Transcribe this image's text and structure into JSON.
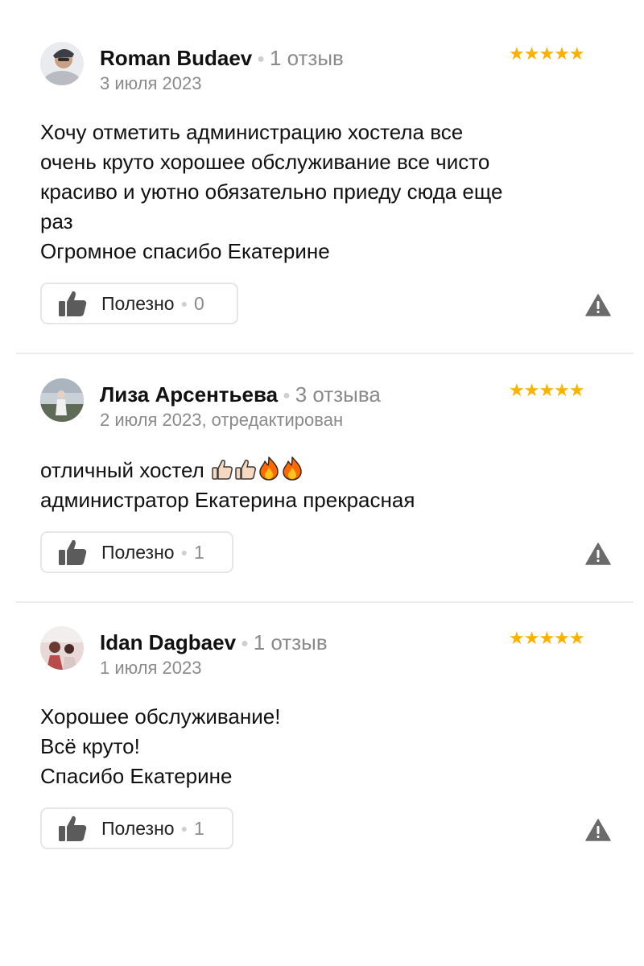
{
  "colors": {
    "star": "#fcb100",
    "muted": "#8a8a8a",
    "divider": "#ebebeb"
  },
  "reviews": [
    {
      "author": "Roman Budaev",
      "review_count": "1 отзыв",
      "date": "3 июля 2023",
      "rating": 5,
      "stars": "★★★★★",
      "text_lines": [
        "Хочу отметить администрацию хостела все",
        "очень круто хорошее обслуживание все чисто",
        "красиво и уютно обязательно приеду сюда еще",
        "раз",
        "Огромное спасибо Екатерине"
      ],
      "useful_label": "Полезно",
      "useful_count": "0"
    },
    {
      "author": "Лиза Арсентьева",
      "review_count": "3 отзыва",
      "date": "2 июля 2023, отредактирован",
      "rating": 5,
      "stars": "★★★★★",
      "text_line1": "отличный хостел",
      "text_line1_emojis": [
        "thumbs-up-icon",
        "thumbs-up-icon",
        "fire-icon",
        "fire-icon"
      ],
      "text_line2": "администратор Екатерина прекрасная",
      "useful_label": "Полезно",
      "useful_count": "1"
    },
    {
      "author": "Idan Dagbaev",
      "review_count": "1 отзыв",
      "date": "1 июля 2023",
      "rating": 5,
      "stars": "★★★★★",
      "text_lines": [
        "Хорошее обслуживание!",
        "Всё круто!",
        "Спасибо Екатерине"
      ],
      "useful_label": "Полезно",
      "useful_count": "1"
    }
  ]
}
